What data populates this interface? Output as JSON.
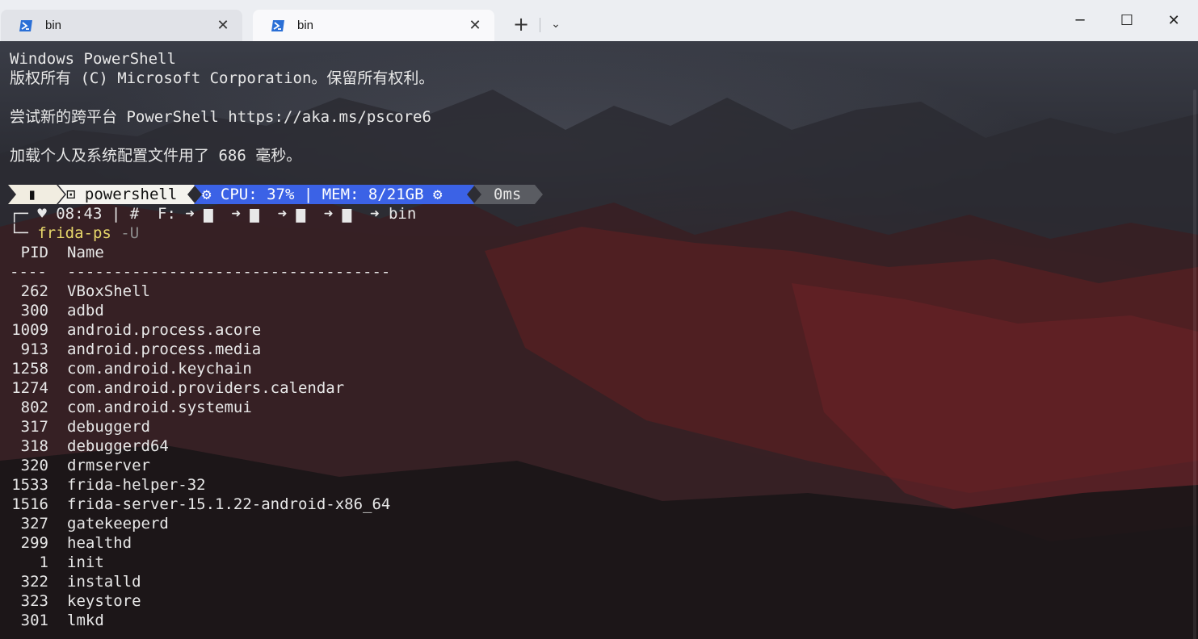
{
  "tabs": [
    {
      "title": "bin",
      "active": false
    },
    {
      "title": "bin",
      "active": true
    }
  ],
  "tab_close_symbol": "✕",
  "new_tab_symbol": "+",
  "dropdown_symbol": "⌄",
  "window_buttons": {
    "minimize": "─",
    "maximize": "☐",
    "close": "✕"
  },
  "colors": {
    "ps_icon": "#2a6fd6",
    "prompt_blue": "#3b62e6",
    "prompt_gray": "#5a5c62",
    "cmd_yellow": "#e6d66a"
  },
  "banner": {
    "line1": "Windows PowerShell",
    "line2": "版权所有 (C) Microsoft Corporation。保留所有权利。",
    "line3": "尝试新的跨平台 PowerShell https://aka.ms/pscore6",
    "line4": "加载个人及系统配置文件用了 686 毫秒。"
  },
  "prompt": {
    "seg1": "▮",
    "seg2": "⊡ powershell",
    "seg3": "⚙ CPU: 37% | MEM: 8/21GB ⚙",
    "seg4": "0ms",
    "line2": "┌─ ♥ 08:43 | #  F: ➜ ▆  ➜ ▆  ➜ ▆  ➜ ▆  ➜ bin",
    "line3_prefix": "└─ ",
    "command": "frida-ps",
    "argument": " -U"
  },
  "table": {
    "header_pid": "PID",
    "header_name": "Name",
    "sep_pid": "----",
    "sep_name": "-----------------------------------",
    "rows": [
      {
        "pid": "262",
        "name": "VBoxShell"
      },
      {
        "pid": "300",
        "name": "adbd"
      },
      {
        "pid": "1009",
        "name": "android.process.acore"
      },
      {
        "pid": "913",
        "name": "android.process.media"
      },
      {
        "pid": "1258",
        "name": "com.android.keychain"
      },
      {
        "pid": "1274",
        "name": "com.android.providers.calendar"
      },
      {
        "pid": "802",
        "name": "com.android.systemui"
      },
      {
        "pid": "317",
        "name": "debuggerd"
      },
      {
        "pid": "318",
        "name": "debuggerd64"
      },
      {
        "pid": "320",
        "name": "drmserver"
      },
      {
        "pid": "1533",
        "name": "frida-helper-32"
      },
      {
        "pid": "1516",
        "name": "frida-server-15.1.22-android-x86_64"
      },
      {
        "pid": "327",
        "name": "gatekeeperd"
      },
      {
        "pid": "299",
        "name": "healthd"
      },
      {
        "pid": "1",
        "name": "init"
      },
      {
        "pid": "322",
        "name": "installd"
      },
      {
        "pid": "323",
        "name": "keystore"
      },
      {
        "pid": "301",
        "name": "lmkd"
      }
    ]
  }
}
